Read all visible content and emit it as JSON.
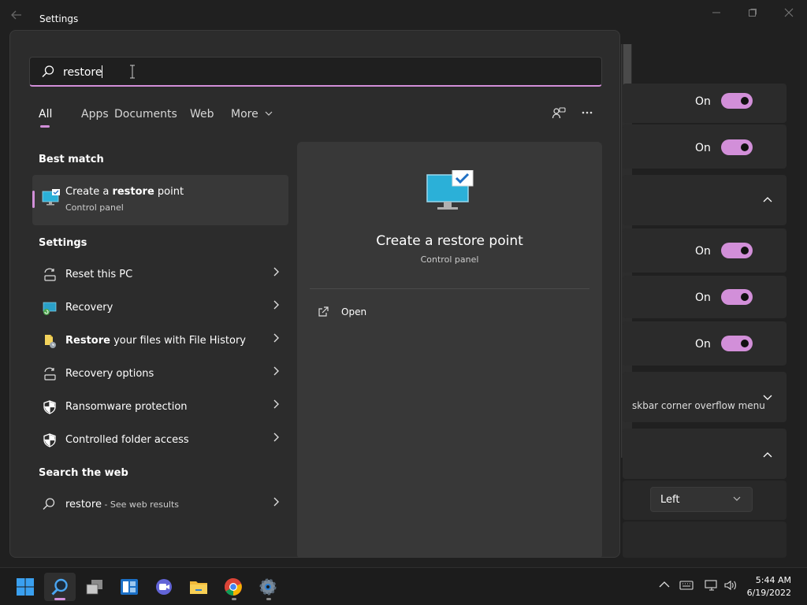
{
  "window": {
    "title": "Settings",
    "back_icon": "back-arrow-icon",
    "controls": [
      "minimize-icon",
      "maximize-icon",
      "close-icon"
    ]
  },
  "background_settings": {
    "toggle_rows": [
      {
        "state": "On"
      },
      {
        "state": "On"
      },
      {
        "state": "On"
      },
      {
        "state": "On"
      },
      {
        "state": "On"
      }
    ],
    "overflow_label": "skbar corner overflow menu",
    "alignment_value": "Left"
  },
  "search": {
    "query": "restore",
    "tabs": [
      "All",
      "Apps",
      "Documents",
      "Web",
      "More"
    ],
    "active_tab": "All",
    "toolbar_icons": [
      "share-icon",
      "more-options-icon"
    ],
    "best_match": {
      "heading": "Best match",
      "title_pre": "Create a ",
      "title_bold": "restore",
      "title_post": " point",
      "subtitle": "Control panel",
      "icon": "monitor-check-icon"
    },
    "settings": {
      "heading": "Settings",
      "items": [
        {
          "pre": "",
          "bold": "",
          "post": "Reset this PC",
          "icon": "reset-pc-icon"
        },
        {
          "pre": "",
          "bold": "",
          "post": "Recovery",
          "icon": "recovery-icon"
        },
        {
          "pre": "",
          "bold": "Restore",
          "post": " your files with File History",
          "icon": "file-history-icon"
        },
        {
          "pre": "",
          "bold": "",
          "post": "Recovery options",
          "icon": "recovery-options-icon"
        },
        {
          "pre": "",
          "bold": "",
          "post": "Ransomware protection",
          "icon": "shield-icon"
        },
        {
          "pre": "",
          "bold": "",
          "post": "Controlled folder access",
          "icon": "shield-icon"
        }
      ]
    },
    "web": {
      "heading": "Search the web",
      "query": "restore",
      "suffix": " - See web results",
      "icon": "search-icon"
    }
  },
  "preview": {
    "title": "Create a restore point",
    "subtitle": "Control panel",
    "action_label": "Open",
    "action_icon": "open-external-icon"
  },
  "taskbar": {
    "apps": [
      "windows-start-icon",
      "search-icon",
      "task-view-icon",
      "widgets-icon",
      "teams-chat-icon",
      "file-explorer-icon",
      "chrome-icon",
      "settings-gear-icon"
    ],
    "tray": [
      "chevron-up-icon",
      "keyboard-icon",
      "network-icon",
      "volume-icon"
    ],
    "time": "5:44 AM",
    "date": "6/19/2022"
  }
}
